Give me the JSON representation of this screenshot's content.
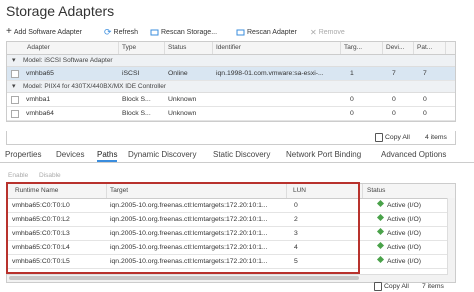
{
  "title": "Storage Adapters",
  "toolbar": {
    "add": "Add Software Adapter",
    "refresh": "Refresh",
    "rescan_storage": "Rescan Storage...",
    "rescan_adapter": "Rescan Adapter",
    "remove": "Remove"
  },
  "adapters": {
    "headers": [
      "Adapter",
      "Type",
      "Status",
      "Identifier",
      "Targ...",
      "Devi...",
      "Pat..."
    ],
    "groups": [
      {
        "label": "Model: iSCSI Software Adapter",
        "rows": [
          {
            "adapter": "vmhba65",
            "type": "iSCSI",
            "status": "Online",
            "identifier": "iqn.1998-01.com.vmware:sa-esxi-...",
            "targets": "1",
            "devices": "7",
            "paths": "7"
          }
        ]
      },
      {
        "label": "Model: PIIX4 for 430TX/440BX/MX IDE Controller",
        "rows": [
          {
            "adapter": "vmhba1",
            "type": "Block S...",
            "status": "Unknown",
            "identifier": "",
            "targets": "0",
            "devices": "0",
            "paths": "0"
          },
          {
            "adapter": "vmhba64",
            "type": "Block S...",
            "status": "Unknown",
            "identifier": "",
            "targets": "0",
            "devices": "0",
            "paths": "0"
          }
        ]
      }
    ],
    "copy_all": "Copy All",
    "count": "4 items"
  },
  "tabs": [
    "Properties",
    "Devices",
    "Paths",
    "Dynamic Discovery",
    "Static Discovery",
    "Network Port Binding",
    "Advanced Options"
  ],
  "active_tab": "Paths",
  "actions": {
    "enable": "Enable",
    "disable": "Disable"
  },
  "paths": {
    "headers": [
      "Runtime Name",
      "Target",
      "LUN",
      "Status"
    ],
    "rows": [
      {
        "runtime": "vmhba65:C0:T0:L0",
        "target": "iqn.2005-10.org.freenas.ctl:lcmtargets:172.20:10:1...",
        "lun": "0",
        "status": "Active (I/O)"
      },
      {
        "runtime": "vmhba65:C0:T0:L2",
        "target": "iqn.2005-10.org.freenas.ctl:lcmtargets:172.20:10:1...",
        "lun": "2",
        "status": "Active (I/O)"
      },
      {
        "runtime": "vmhba65:C0:T0:L3",
        "target": "iqn.2005-10.org.freenas.ctl:lcmtargets:172.20:10:1...",
        "lun": "3",
        "status": "Active (I/O)"
      },
      {
        "runtime": "vmhba65:C0:T0:L4",
        "target": "iqn.2005-10.org.freenas.ctl:lcmtargets:172.20:10:1...",
        "lun": "4",
        "status": "Active (I/O)"
      },
      {
        "runtime": "vmhba65:C0:T0:L5",
        "target": "iqn.2005-10.org.freenas.ctl:lcmtargets:172.20:10:1...",
        "lun": "5",
        "status": "Active (I/O)"
      }
    ],
    "copy_all": "Copy All",
    "count": "7 items"
  },
  "colors": {
    "accent": "#3a8dde",
    "highlight": "#b8322d",
    "status_ok": "#4aa24a",
    "selected_row": "#d9e6f2"
  }
}
